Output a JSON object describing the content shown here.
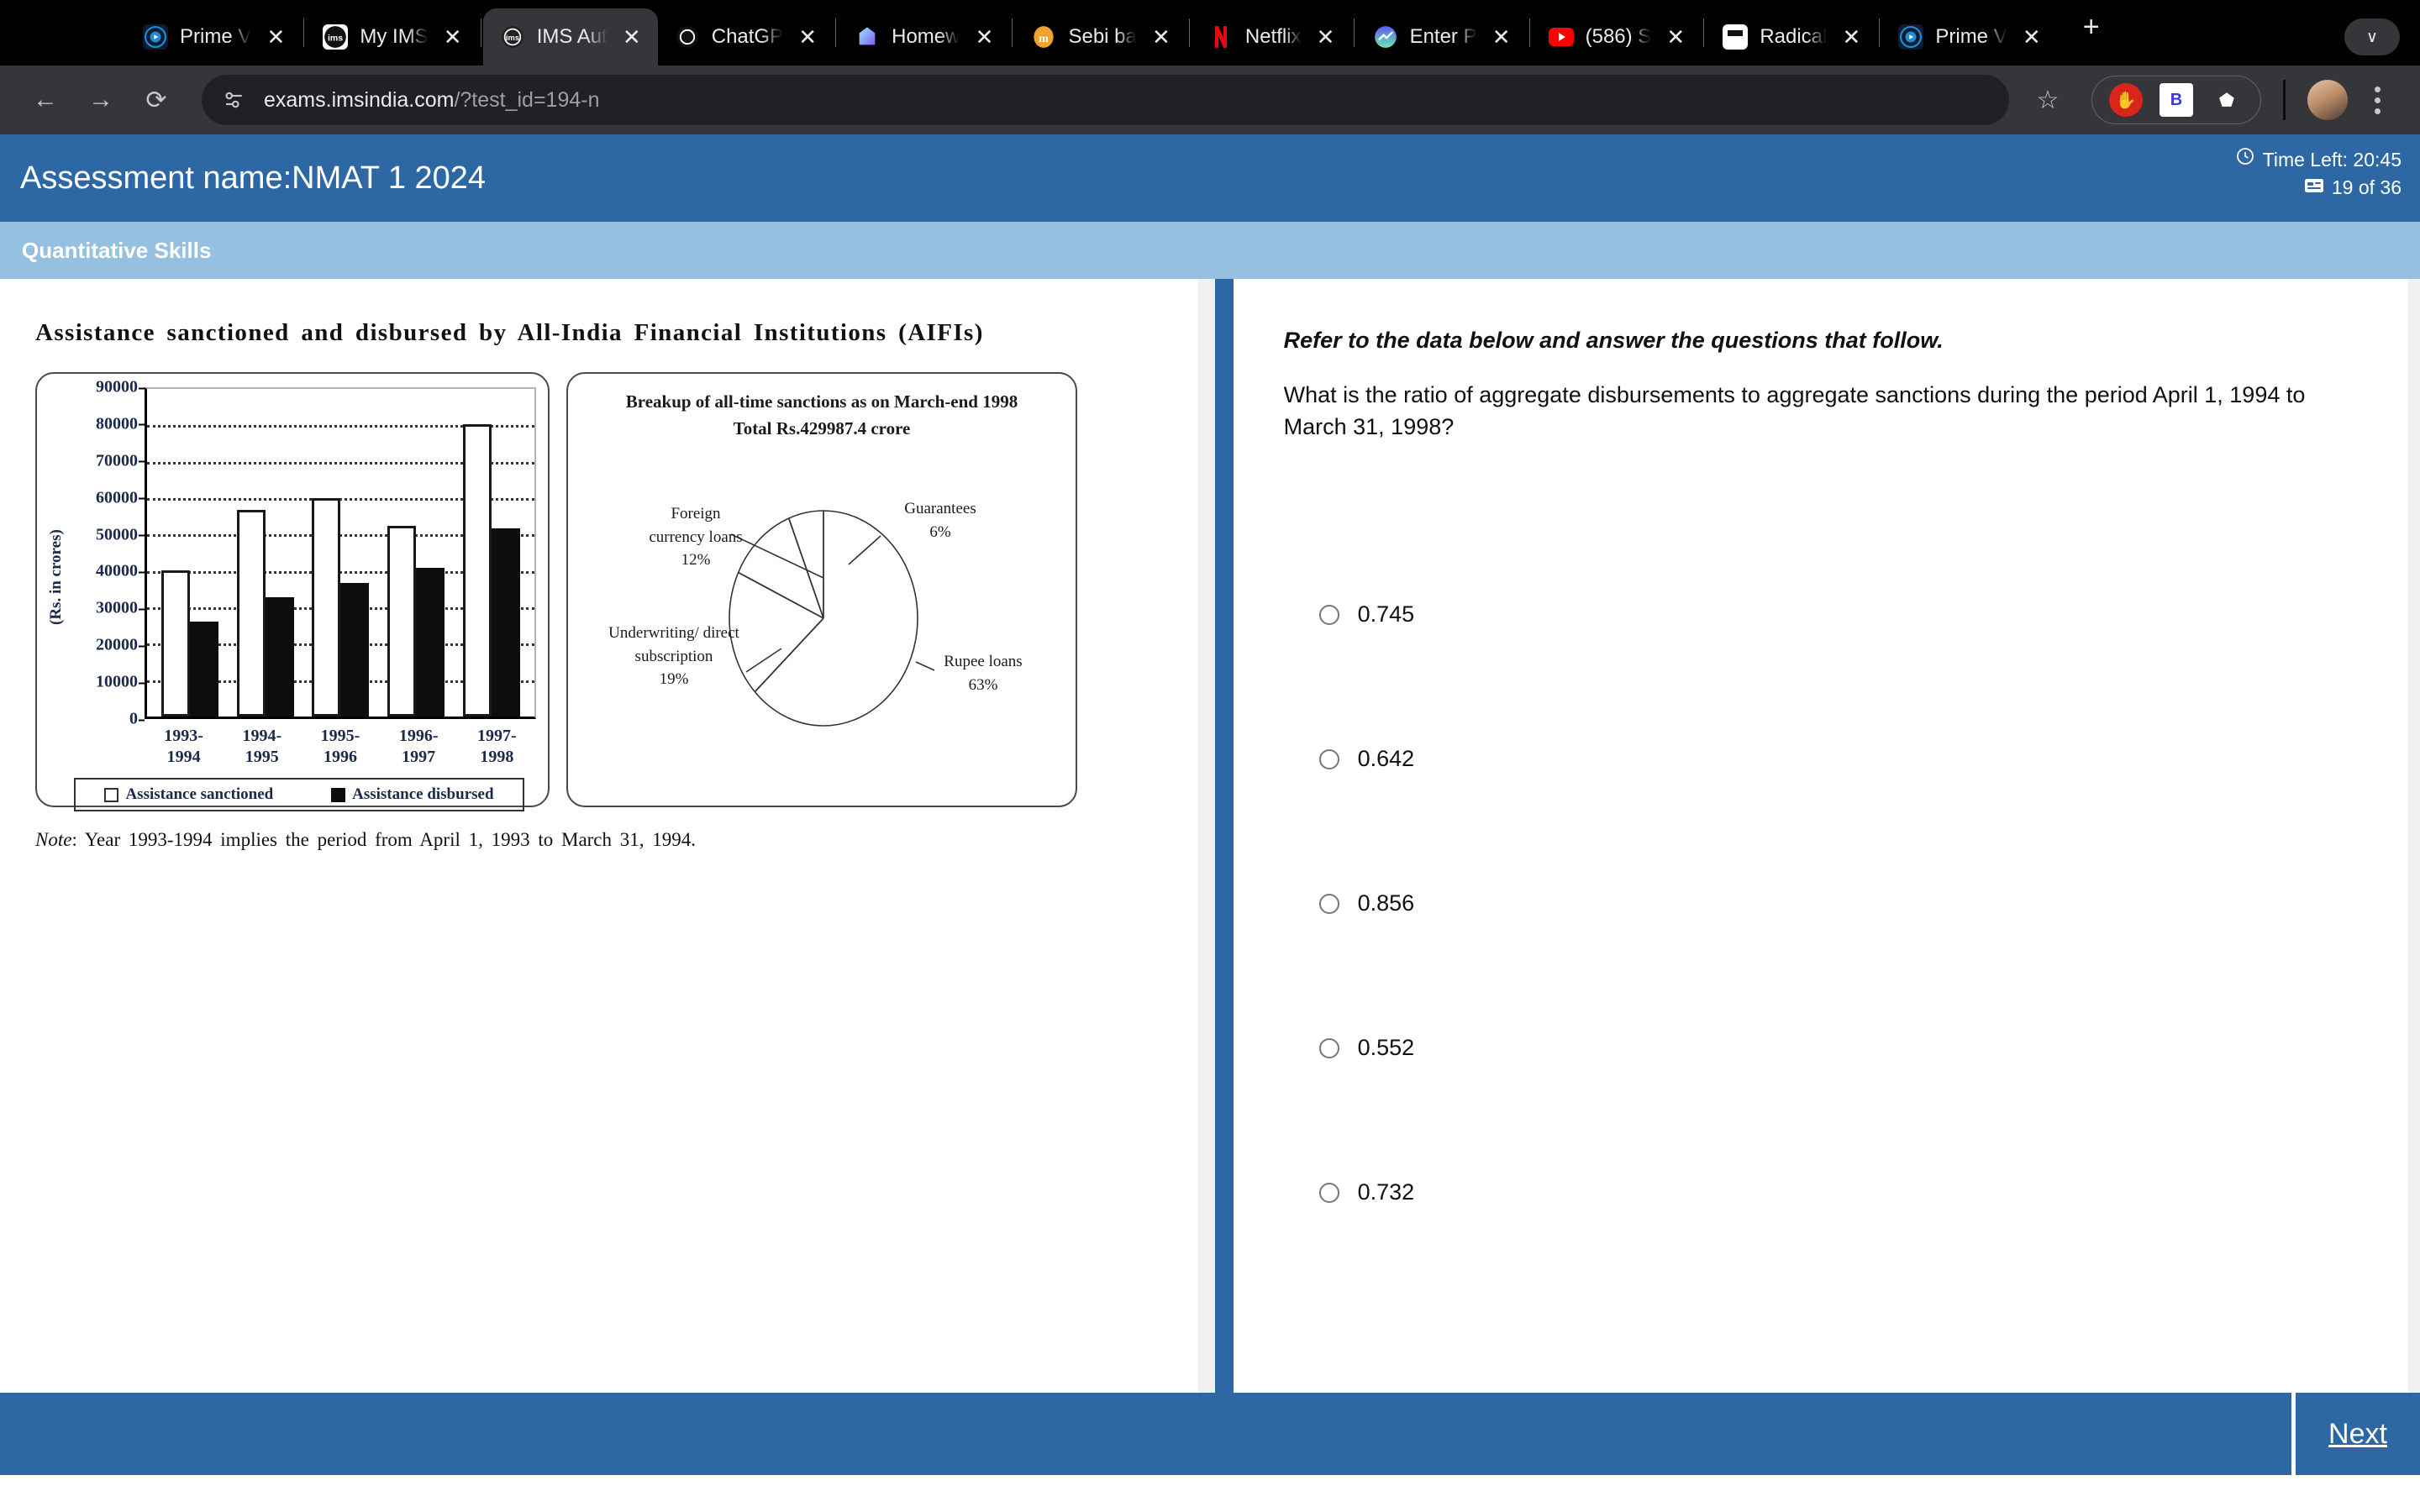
{
  "browser": {
    "tabs": [
      {
        "title": "Prime V",
        "favicon": "prime-video-icon",
        "active": false
      },
      {
        "title": "My IMS",
        "favicon": "ims-icon",
        "active": false
      },
      {
        "title": "IMS Aut",
        "favicon": "ims-icon",
        "active": true
      },
      {
        "title": "ChatGP",
        "favicon": "chatgpt-icon",
        "active": false
      },
      {
        "title": "Homew",
        "favicon": "homework-icon",
        "active": false
      },
      {
        "title": "Sebi ba",
        "favicon": "sebi-icon",
        "active": false
      },
      {
        "title": "Netflix",
        "favicon": "netflix-icon",
        "active": false
      },
      {
        "title": "Enter P",
        "favicon": "enter-icon",
        "active": false
      },
      {
        "title": "(586) S",
        "favicon": "youtube-icon",
        "active": false
      },
      {
        "title": "Radical",
        "favicon": "radical-icon",
        "active": false
      },
      {
        "title": "Prime V",
        "favicon": "prime-video-icon",
        "active": false
      }
    ],
    "new_tab_label": "+",
    "tab_search_label": "∨",
    "close_label": "✕",
    "back_label": "←",
    "forward_label": "→",
    "reload_label": "⟳",
    "url_host": "exams.imsindia.com",
    "url_path": "/?test_id=194-n",
    "star_label": "☆",
    "extensions": [
      {
        "name": "adblock-icon",
        "label": "✋"
      },
      {
        "name": "bitwarden-icon",
        "label": "B"
      },
      {
        "name": "extensions-puzzle-icon",
        "label": "⬟"
      }
    ]
  },
  "exam": {
    "title": "Assessment name:NMAT 1 2024",
    "time_left": "Time Left: 20:45",
    "question_counter": "19 of 36",
    "clock_icon": "clock-icon",
    "counter_icon": "question-palette-icon",
    "section_name": "Quantitative Skills",
    "next_label": "Next"
  },
  "stimulus": {
    "title": "Assistance sanctioned and disbursed by All-India Financial Institutions (AIFIs)",
    "note_prefix": "Note",
    "note_body": ": Year 1993-1994 implies the period from April 1, 1993 to March 31, 1994."
  },
  "question": {
    "instruction": "Refer to the data below and answer the questions that follow.",
    "text": "What is the ratio of aggregate disbursements to aggregate sanctions during the period April 1, 1994 to March 31, 1998?",
    "options": [
      {
        "label": "0.745",
        "selected": false
      },
      {
        "label": "0.642",
        "selected": false
      },
      {
        "label": "0.856",
        "selected": false
      },
      {
        "label": "0.552",
        "selected": false
      },
      {
        "label": "0.732",
        "selected": false
      }
    ]
  },
  "chart_data": [
    {
      "type": "bar",
      "title": "Assistance sanctioned and disbursed by All-India Financial Institutions (AIFIs)",
      "xlabel": "",
      "ylabel": "(Rs. in crores)",
      "categories": [
        "1993-\n1994",
        "1994-\n1995",
        "1995-\n1996",
        "1996-\n1997",
        "1997-\n1998"
      ],
      "series": [
        {
          "name": "Assistance sanctioned",
          "values": [
            40200,
            56800,
            60000,
            52500,
            80200
          ]
        },
        {
          "name": "Assistance disbursed",
          "values": [
            26000,
            32800,
            36700,
            40800,
            51800
          ]
        }
      ],
      "ylim": [
        0,
        90000
      ],
      "yticks": [
        0,
        10000,
        20000,
        30000,
        40000,
        50000,
        60000,
        70000,
        80000,
        90000
      ],
      "grid": true,
      "legend_position": "bottom"
    },
    {
      "type": "pie",
      "title": "Breakup of all-time sanctions as on March-end 1998",
      "subtitle": "Total Rs.429987.4 crore",
      "labels": [
        "Rupee loans",
        "Underwriting/ direct subscription",
        "Foreign currency loans",
        "Guarantees"
      ],
      "values": [
        63,
        19,
        12,
        6
      ],
      "value_suffix": "%",
      "annotations": [
        {
          "text": "Guarantees",
          "value": "6%"
        },
        {
          "text": "Rupee loans",
          "value": "63%"
        },
        {
          "text": "Underwriting/ direct subscription",
          "value": "19%"
        },
        {
          "text": "Foreign currency loans",
          "value": "12%"
        }
      ],
      "legend_position": "callout-labels"
    }
  ]
}
